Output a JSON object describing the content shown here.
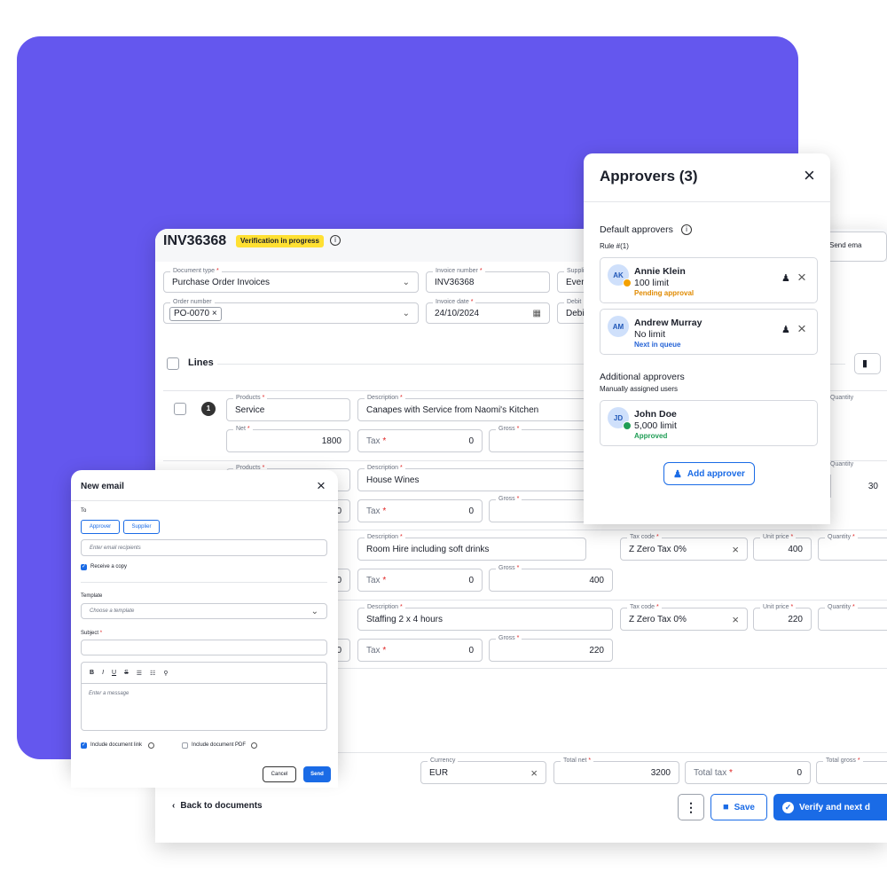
{
  "invoice": {
    "id": "INV36368",
    "status": "Verification in progress",
    "send_email_partial": "Send ema",
    "fields": {
      "document_type": {
        "label": "Document type",
        "value": "Purchase Order Invoices"
      },
      "invoice_number": {
        "label": "Invoice number",
        "value": "INV36368"
      },
      "supplier": {
        "label": "Suppli",
        "value": "Even"
      },
      "order_number": {
        "label": "Order number",
        "chip": "PO-0070"
      },
      "invoice_date": {
        "label": "Invoice date",
        "value": "24/10/2024"
      },
      "debit": {
        "label": "Debit",
        "value": "Debi"
      }
    },
    "lines_label": "Lines",
    "labels": {
      "products": "Products",
      "description": "Description",
      "net": "Net",
      "tax": "Tax",
      "gross": "Gross",
      "tax_code": "Tax code",
      "unit_price": "Unit price",
      "quantity": "Quantity",
      "quantity_clip": "Quantity"
    },
    "lines": [
      {
        "index": "1",
        "product": "Service",
        "description": "Canapes with Service from Naomi's Kitchen",
        "net": "1800",
        "tax": "0",
        "gross": ""
      },
      {
        "product": "",
        "description": "House Wines",
        "net_partial": "0",
        "tax": "0",
        "quantity_partial": "30"
      },
      {
        "description": "Room Hire including soft drinks",
        "net_partial": "0",
        "tax": "0",
        "gross": "400",
        "tax_code": "Z Zero Tax 0%",
        "unit_price": "400"
      },
      {
        "description": "Staffing 2 x 4 hours",
        "net_partial": "0",
        "tax": "0",
        "gross": "220",
        "tax_code": "Z Zero Tax 0%",
        "unit_price": "220"
      }
    ],
    "footer": {
      "currency_label": "Currency",
      "currency": "EUR",
      "total_net_label": "Total net",
      "total_net": "3200",
      "total_tax_label": "Total tax",
      "total_tax": "0",
      "total_gross_label": "Total gross",
      "back": "Back to documents",
      "save": "Save",
      "verify": "Verify and next d"
    }
  },
  "approvers": {
    "title": "Approvers (3)",
    "default_title": "Default approvers",
    "rule": "Rule #(1)",
    "default": [
      {
        "initials": "AK",
        "name": "Annie Klein",
        "limit": "100 limit",
        "status": "Pending approval",
        "status_color": "#e08a00"
      },
      {
        "initials": "AM",
        "name": "Andrew Murray",
        "limit": "No limit",
        "status": "Next in queue",
        "status_color": "#2563d6"
      }
    ],
    "additional_title": "Additional approvers",
    "additional_sub": "Manually assigned users",
    "additional": [
      {
        "initials": "JD",
        "name": "John Doe",
        "limit": "5,000 limit",
        "status": "Approved",
        "status_color": "#1f9d55"
      }
    ],
    "add_button": "Add approver"
  },
  "email": {
    "title": "New email",
    "to_label": "To",
    "chips": [
      "Approver",
      "Supplier"
    ],
    "recipients_placeholder": "Enter email recipients",
    "receive_copy": "Receive a copy",
    "template_label": "Template",
    "template_placeholder": "Choose a template",
    "subject_label": "Subject",
    "toolbar": [
      "B",
      "I",
      "U",
      "S"
    ],
    "message_placeholder": "Enter a message",
    "include_link": "Include document link",
    "include_pdf": "Include document PDF",
    "cancel": "Cancel",
    "send": "Send"
  },
  "colors": {
    "accent": "#6457ee",
    "primary": "#1a6be6",
    "status_badge": "#ffe033"
  }
}
